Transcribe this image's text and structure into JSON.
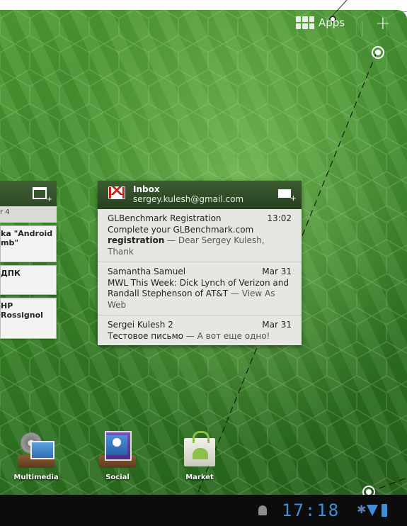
{
  "top": {
    "apps_label": "Apps",
    "add_label": "+"
  },
  "left_widget": {
    "sub": "r 4",
    "items": [
      {
        "text": "ka \"Android\nmb\""
      },
      {
        "text": "ДПК"
      },
      {
        "text": "HP\nRossignol"
      }
    ]
  },
  "inbox": {
    "title": "Inbox",
    "account": "sergey.kulesh@gmail.com",
    "messages": [
      {
        "sender": "GLBenchmark Registration",
        "date": "13:02",
        "subject": "Complete your GLBenchmark.com",
        "subject2": "registration",
        "snippet": " — Dear Sergey Kulesh, Thank"
      },
      {
        "sender": "Samantha Samuel",
        "date": "Mar 31",
        "subject": "MWL This Week: Dick Lynch of Verizon and",
        "subject2": "Randall Stephenson of AT&T",
        "snippet": " — View As Web"
      },
      {
        "sender": "Sergei Kulesh  2",
        "date": "Mar 31",
        "subject": "",
        "subject2": "Тестовое письмо",
        "snippet": " — А вот еще одно!"
      }
    ]
  },
  "dock": [
    {
      "label": "Multimedia",
      "icon": "multimedia-icon"
    },
    {
      "label": "Social",
      "icon": "social-icon"
    },
    {
      "label": "Market",
      "icon": "market-icon"
    }
  ],
  "status": {
    "clock": "17:18",
    "bluetooth": "✱"
  },
  "colors": {
    "clock": "#3f8fd8",
    "wallpaper": "#3c8a2a",
    "widget_header": "#2e4a26"
  }
}
